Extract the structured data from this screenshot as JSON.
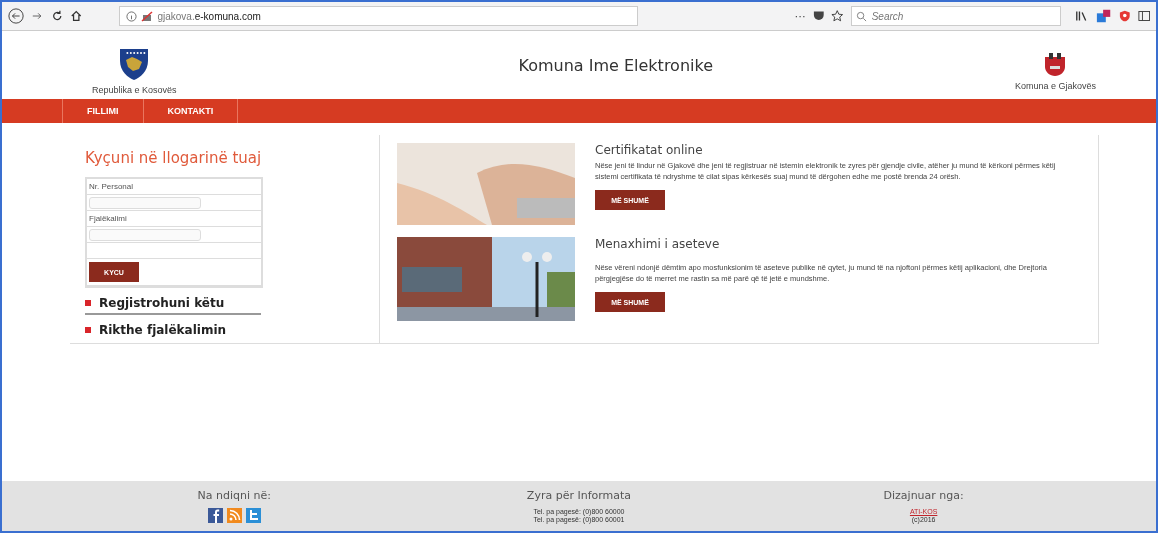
{
  "browser": {
    "url_prefix": "gjakova.",
    "url_domain": "e-komuna.com",
    "more": "···",
    "search": {
      "placeholder": "Search"
    }
  },
  "header": {
    "left_caption": "Republika e Kosovës",
    "title": "Komuna Ime Elektronike",
    "right_caption": "Komuna e Gjakovës"
  },
  "nav": [
    {
      "label": "FILLIMI"
    },
    {
      "label": "KONTAKTI"
    }
  ],
  "login": {
    "title": "Kyçuni në llogarinë tuaj",
    "fields": [
      {
        "label": "Nr. Personal"
      },
      {
        "label": "Fjalëkalimi"
      }
    ],
    "button": "KYCU",
    "links": [
      "Regjistrohuni këtu",
      "Rikthe fjalëkalimin"
    ]
  },
  "articles": [
    {
      "kind": "hands",
      "title": "Certifikatat online",
      "text": "Nëse jeni të lindur në Gjakovë dhe jeni të regjistruar në istemin elektronik te zyres për gjendje civile, atëher ju mund të kërkoni përmes këtij sistemi certifikata të ndryshme të cilat sipas kërkesës suaj mund të dërgohen edhe me postë brenda 24 orësh.",
      "button": "MË SHUMË"
    },
    {
      "kind": "street",
      "title": "Menaxhimi i aseteve",
      "text": "Nëse vëreni ndonjë dëmtim apo mosfunksionim të aseteve publike në qytet, ju  mund të na njoftoni përmes këtij aplikacioni, dhe Drejtoria përgjegjëse do të merret me rastin sa më parë që të jetë e mundshme.",
      "button": "MË SHUMË"
    }
  ],
  "footer": {
    "follow": "Na ndiqni në:",
    "office": {
      "title": "Zyra për Informata",
      "lines": [
        "Tel. pa pagesë: (0)800 60000",
        "Tel. pa pagesë: (0)800 60001"
      ]
    },
    "design": {
      "title": "Dizajnuar nga:",
      "link": "ATI-KOS",
      "year": "(c)2016"
    }
  }
}
